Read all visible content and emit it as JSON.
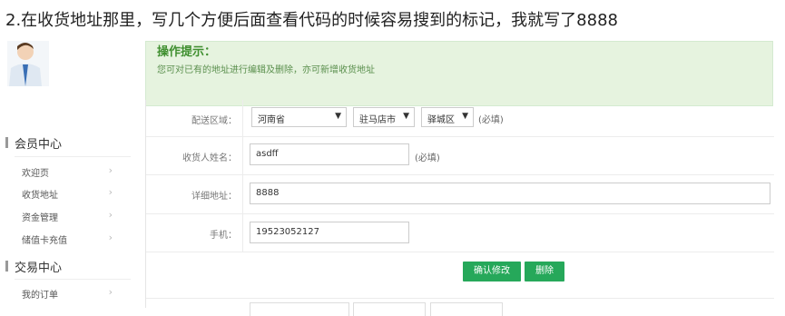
{
  "caption": "2.在收货地址那里，写几个方便后面查看代码的时候容易搜到的标记，我就写了8888",
  "tips": {
    "title": "操作提示：",
    "text": "您可对已有的地址进行编辑及删除，亦可新增收货地址"
  },
  "sidebar": {
    "group1": "会员中心",
    "items1": [
      "欢迎页",
      "收货地址",
      "资金管理",
      "储值卡充值"
    ],
    "group2": "交易中心",
    "items2": [
      "我的订单"
    ]
  },
  "form": {
    "region_label": "配送区域：",
    "province": "河南省",
    "city": "驻马店市",
    "district": "驿城区",
    "required_hint": "(必填)",
    "name_label": "收货人姓名：",
    "name_value": "asdff",
    "address_label": "详细地址：",
    "address_value": "8888",
    "phone_label": "手机：",
    "phone_value": "19523052127",
    "confirm_label": "确认修改",
    "delete_label": "删除"
  },
  "colors": {
    "accent": "#26a85a",
    "tips_bg": "#e6f3df",
    "tips_title": "#3f8f2f"
  }
}
